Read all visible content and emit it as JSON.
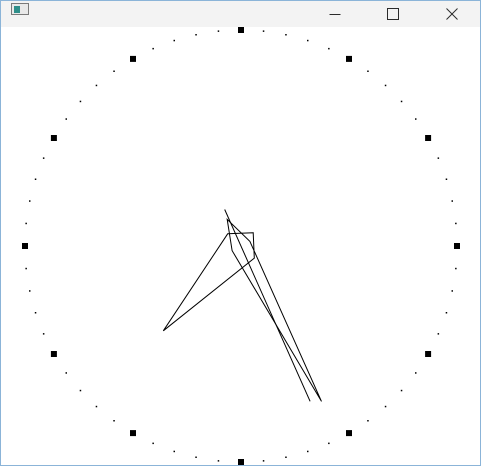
{
  "window": {
    "title": "",
    "icon": "app-window-icon",
    "controls": {
      "minimize_icon": "minimize-icon",
      "maximize_icon": "maximize-icon",
      "close_icon": "close-icon"
    }
  },
  "clock": {
    "time": {
      "hours": 7,
      "minutes": 25,
      "seconds": 26
    },
    "dial": {
      "hour_markers": 12,
      "minute_dots": 60,
      "marker_color": "#000000"
    },
    "hands_color": "#000000",
    "background": "#ffffff"
  }
}
